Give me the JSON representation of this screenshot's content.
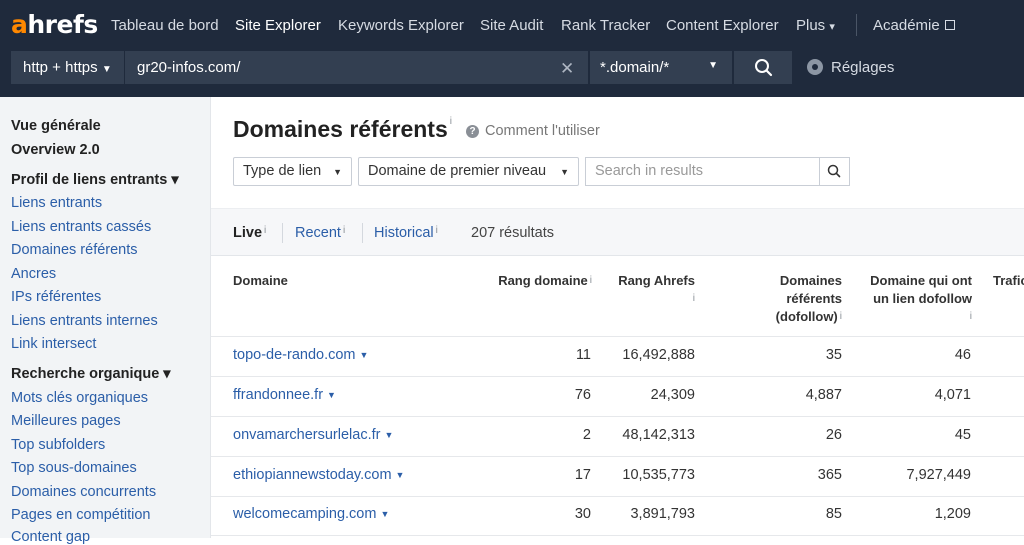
{
  "brand": {
    "first": "a",
    "rest": "hrefs",
    "accent": "#ff8800"
  },
  "nav": {
    "items": [
      "Tableau de bord",
      "Site Explorer",
      "Keywords Explorer",
      "Site Audit",
      "Rank Tracker",
      "Content Explorer",
      "Plus"
    ],
    "plus_caret": "▾",
    "academy": "Académie"
  },
  "search": {
    "protocol": "http + https",
    "url": "gr20-infos.com/",
    "clear": "✕",
    "mode": "*.domain/*",
    "settings": "Réglages"
  },
  "sidebar": {
    "overview": "Vue générale",
    "overview2": "Overview 2.0",
    "backlinks_header": "Profil de liens entrants ▾",
    "backlinks": [
      "Liens entrants",
      "Liens entrants cassés",
      "Domaines référents",
      "Ancres",
      "IPs référentes",
      "Liens entrants internes",
      "Link intersect"
    ],
    "organic_header": "Recherche organique ▾",
    "organic": [
      "Mots clés organiques",
      "Meilleures pages",
      "Top subfolders",
      "Top sous-domaines",
      "Domaines concurrents",
      "Pages en compétition",
      "Content gap"
    ]
  },
  "main": {
    "title": "Domaines référents",
    "info": "i",
    "howto": "Comment l'utiliser",
    "filters": {
      "link_type": "Type de lien",
      "tld": "Domaine de premier niveau",
      "search_placeholder": "Search in results"
    },
    "tabs": [
      "Live",
      "Recent",
      "Historical"
    ],
    "count": "207 résultats"
  },
  "table": {
    "headers": {
      "domain": "Domaine",
      "dr": "Rang domaine",
      "ahrefs_rank": "Rang Ahrefs",
      "ref_domains": [
        "Domaines",
        "référents",
        "(dofollow)"
      ],
      "dofollow": [
        "Domaine qui ont",
        "un lien dofollow"
      ],
      "traffic": "Trafic"
    },
    "rows": [
      {
        "domain": "topo-de-rando.com",
        "dr": "11",
        "rank": "16,492,888",
        "ref": "35",
        "dofollow": "46"
      },
      {
        "domain": "ffrandonnee.fr",
        "dr": "76",
        "rank": "24,309",
        "ref": "4,887",
        "dofollow": "4,071"
      },
      {
        "domain": "onvamarchersurlelac.fr",
        "dr": "2",
        "rank": "48,142,313",
        "ref": "26",
        "dofollow": "45"
      },
      {
        "domain": "ethiopiannewstoday.com",
        "dr": "17",
        "rank": "10,535,773",
        "ref": "365",
        "dofollow": "7,927,449"
      },
      {
        "domain": "welcomecamping.com",
        "dr": "30",
        "rank": "3,891,793",
        "ref": "85",
        "dofollow": "1,209"
      }
    ]
  },
  "colors": {
    "nav_bg": "#1f2a3c",
    "link": "#2b5ea8",
    "sidebar_bg": "#f2f4f6"
  }
}
